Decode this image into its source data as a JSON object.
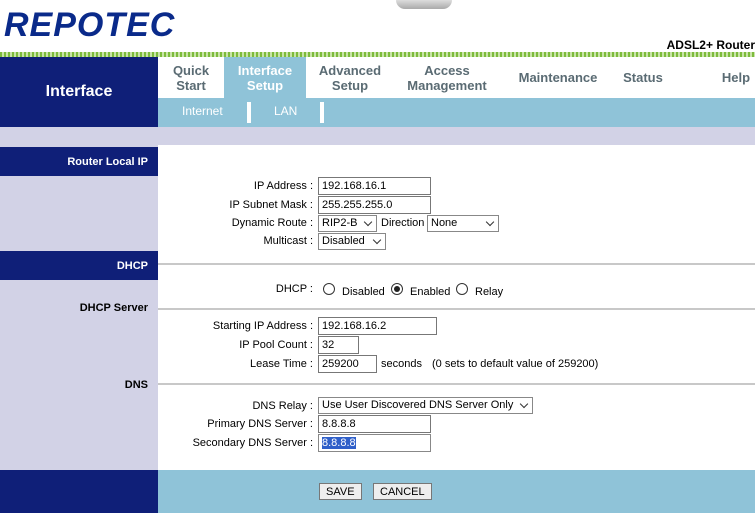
{
  "header": {
    "logo": "REPOTEC",
    "model": "ADSL2+ Router"
  },
  "nav": {
    "section": "Interface",
    "tabs": [
      {
        "line1": "Quick",
        "line2": "Start"
      },
      {
        "line1": "Interface",
        "line2": "Setup"
      },
      {
        "line1": "Advanced",
        "line2": "Setup"
      },
      {
        "line1": "Access",
        "line2": "Management"
      },
      {
        "line1": "Maintenance",
        "line2": ""
      },
      {
        "line1": "Status",
        "line2": ""
      },
      {
        "line1": "Help",
        "line2": ""
      }
    ],
    "subtabs": [
      "Internet",
      "LAN"
    ]
  },
  "sections": {
    "router_local_ip": "Router Local IP",
    "dhcp": "DHCP",
    "dhcp_server": "DHCP Server",
    "dns": "DNS"
  },
  "lan": {
    "ip_address_label": "IP Address :",
    "ip_address": "192.168.16.1",
    "subnet_mask_label": "IP Subnet Mask :",
    "subnet_mask": "255.255.255.0",
    "dynamic_route_label": "Dynamic Route :",
    "dynamic_route": "RIP2-B",
    "direction_label": "Direction",
    "direction": "None",
    "multicast_label": "Multicast :",
    "multicast": "Disabled"
  },
  "dhcp": {
    "label": "DHCP :",
    "options": [
      "Disabled",
      "Enabled",
      "Relay"
    ],
    "selected": "Enabled",
    "start_ip_label": "Starting IP Address :",
    "start_ip": "192.168.16.2",
    "pool_count_label": "IP Pool Count :",
    "pool_count": "32",
    "lease_time_label": "Lease Time :",
    "lease_time": "259200",
    "lease_unit": "seconds",
    "lease_note": "(0 sets to default value of 259200)"
  },
  "dns": {
    "relay_label": "DNS Relay :",
    "relay": "Use User Discovered DNS Server Only",
    "primary_label": "Primary DNS Server :",
    "primary": "8.8.8.8",
    "secondary_label": "Secondary DNS Server :",
    "secondary": "8.8.8.8"
  },
  "buttons": {
    "save": "SAVE",
    "cancel": "CANCEL"
  },
  "colors": {
    "navy": "#0f1f78",
    "light_blue": "#8fc3d8",
    "lavender": "#d2d2e6",
    "green": "#7dbb3c"
  }
}
